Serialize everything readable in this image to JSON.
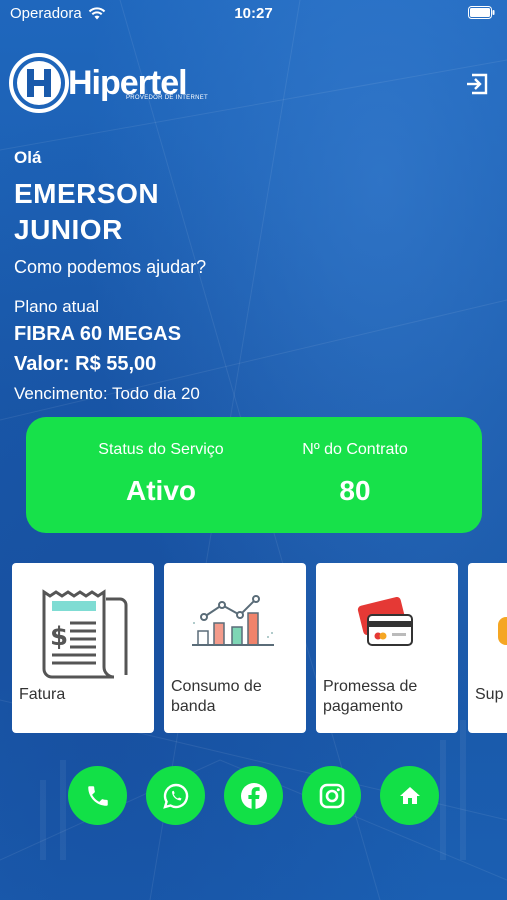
{
  "status_bar": {
    "carrier": "Operadora",
    "time": "10:27"
  },
  "brand": {
    "name": "Hipertel",
    "tagline": "PROVEDOR DE INTERNET"
  },
  "greeting": {
    "hello": "Olá",
    "first_name": "EMERSON",
    "last_name": "JUNIOR",
    "prompt": "Como podemos ajudar?"
  },
  "plan": {
    "label": "Plano atual",
    "name": "FIBRA 60 MEGAS",
    "value": "Valor: R$ 55,00",
    "due": "Vencimento: Todo dia 20"
  },
  "service": {
    "status_label": "Status do Serviço",
    "status_value": "Ativo",
    "contract_label": "Nº do Contrato",
    "contract_value": "80"
  },
  "menu_cards": [
    {
      "label": "Fatura",
      "icon": "invoice-icon"
    },
    {
      "label_line1": "Consumo de",
      "label_line2": "banda",
      "icon": "bar-chart-icon"
    },
    {
      "label_line1": "Promessa de",
      "label_line2": "pagamento",
      "icon": "credit-card-icon"
    },
    {
      "label": "Sup",
      "icon": "support-icon"
    }
  ],
  "social_buttons": [
    "phone-icon",
    "whatsapp-icon",
    "facebook-icon",
    "instagram-icon",
    "home-icon"
  ],
  "colors": {
    "background": "#1a5aab",
    "accent_green": "#17e14a",
    "card": "#ffffff"
  }
}
